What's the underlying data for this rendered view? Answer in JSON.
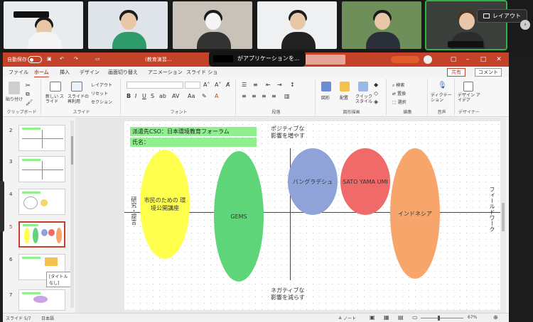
{
  "video": {
    "layout_label": "レイアウト",
    "participants": 6
  },
  "window": {
    "autosave_label": "自動保存",
    "autosave_state": "オフ",
    "file_name": "(教育演習…",
    "share_overlay_text": "がアプリケーションを..."
  },
  "menu": {
    "tabs": [
      "ファイル",
      "ホーム",
      "挿入",
      "デザイン",
      "画面切り替え",
      "アニメーション",
      "スライド ショ"
    ],
    "active_tab": "ホーム",
    "share": "共有",
    "comment": "コメント"
  },
  "ribbon": {
    "clipboard": {
      "paste": "貼り付け",
      "label": "クリップボード"
    },
    "slides": {
      "new_slide": "新しい スライド",
      "reuse": "スライドの 再利用",
      "layout": "レイアウト",
      "reset": "リセット",
      "section": "セクション",
      "label": "スライド"
    },
    "font": {
      "label": "フォント"
    },
    "paragraph": {
      "label": "段落"
    },
    "drawing": {
      "shapes": "図形",
      "arrange": "配置",
      "quick_styles": "クイック スタイル",
      "label": "図形描画"
    },
    "editing": {
      "find": "検索",
      "replace": "置換",
      "select": "選択",
      "label": "編集"
    },
    "voice": {
      "dictate": "ディクテー ション",
      "label": "音声"
    },
    "designer": {
      "ideas": "デザイン アイデア",
      "label": "デザイナー"
    }
  },
  "thumbnails": {
    "numbers": [
      "2",
      "3",
      "4",
      "5",
      "6",
      "7"
    ],
    "selected": "5",
    "tooltip": "[タイトルなし]"
  },
  "slide": {
    "header_line1": "派遣先CSO：日本環境教育フォーラム",
    "header_line2": "氏名：",
    "top_label_1": "ポジティブな",
    "top_label_2": "影響を増やす",
    "bottom_label_1": "ネガティブな",
    "bottom_label_2": "影響を減らす",
    "left_axis": "研究・提言",
    "right_axis": "フィールドワーク",
    "ellipses": [
      {
        "text": "市民のための 環境公開講座",
        "color": "#ffff4d"
      },
      {
        "text": "GEMS",
        "color": "#5fd57a"
      },
      {
        "text": "バングラデシュ",
        "color": "#8fa3d8"
      },
      {
        "text": "SATO YAMA UMI",
        "color": "#f06a6a"
      },
      {
        "text": "インドネシア",
        "color": "#f7a56a"
      }
    ]
  },
  "status": {
    "slide_pos": "スライド 5/7",
    "language": "日本語",
    "notes": "ノート",
    "zoom": "67%"
  },
  "colors": {
    "accent": "#c5422a"
  }
}
